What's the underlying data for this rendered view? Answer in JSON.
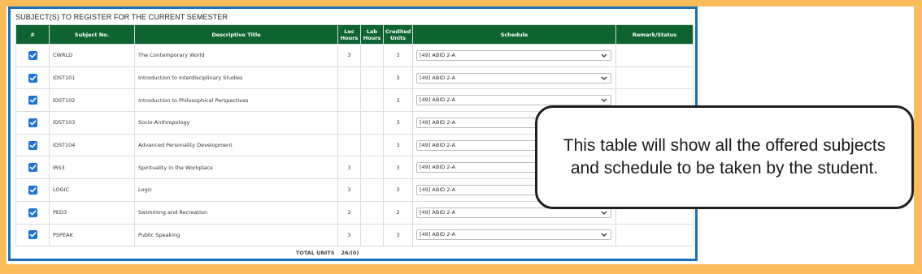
{
  "panel": {
    "title": "SUBJECT(S) TO REGISTER FOR THE CURRENT SEMESTER",
    "border_color": "#1b6fc0"
  },
  "table": {
    "header_color": "#0d6431",
    "headers": {
      "num": "#",
      "subject_no": "Subject No.",
      "title": "Descriptive Title",
      "lec": "Lec Hours",
      "lab": "Lab Hours",
      "credited": "Credited Units",
      "schedule": "Schedule",
      "remark": "Remark/Status"
    },
    "rows": [
      {
        "checked": true,
        "subject_no": "CWRLD",
        "title": "The Contemporary World",
        "lec": "3",
        "lab": "",
        "units": "3",
        "schedule": "[49] ABID 2-A",
        "remark": ""
      },
      {
        "checked": true,
        "subject_no": "IDST101",
        "title": "Introduction to Interdisciplinary Studies",
        "lec": "",
        "lab": "",
        "units": "3",
        "schedule": "[49] ABID 2-A",
        "remark": ""
      },
      {
        "checked": true,
        "subject_no": "IDST102",
        "title": "Introduction to Philosophical Perspectives",
        "lec": "",
        "lab": "",
        "units": "3",
        "schedule": "[49] ABID 2-A",
        "remark": ""
      },
      {
        "checked": true,
        "subject_no": "IDST103",
        "title": "Socio-Anthropology",
        "lec": "",
        "lab": "",
        "units": "3",
        "schedule": "[49] ABID 2-A",
        "remark": ""
      },
      {
        "checked": true,
        "subject_no": "IDST104",
        "title": "Advanced Personality Development",
        "lec": "",
        "lab": "",
        "units": "3",
        "schedule": "[49] ABID 2-A",
        "remark": ""
      },
      {
        "checked": true,
        "subject_no": "IRS3",
        "title": "Spirituality in the Workplace",
        "lec": "3",
        "lab": "",
        "units": "3",
        "schedule": "[49] ABID 2-A",
        "remark": ""
      },
      {
        "checked": true,
        "subject_no": "LOGIC",
        "title": "Logic",
        "lec": "3",
        "lab": "",
        "units": "3",
        "schedule": "[49] ABID 2-A",
        "remark": ""
      },
      {
        "checked": true,
        "subject_no": "PED3",
        "title": "Swimming and Recreation",
        "lec": "2",
        "lab": "",
        "units": "2",
        "schedule": "[49] ABID 2-A",
        "remark": ""
      },
      {
        "checked": true,
        "subject_no": "PSPEAK",
        "title": "Public Speaking",
        "lec": "3",
        "lab": "",
        "units": "3",
        "schedule": "[49] ABID 2-A",
        "remark": ""
      }
    ],
    "total_label": "TOTAL UNITS",
    "total_value": "26/(0)"
  },
  "callout": {
    "text": "This table will show all the offered subjects and schedule to be taken by the student."
  },
  "colors": {
    "frame": "#fbbd59",
    "checkbox": "#1c74d8"
  }
}
